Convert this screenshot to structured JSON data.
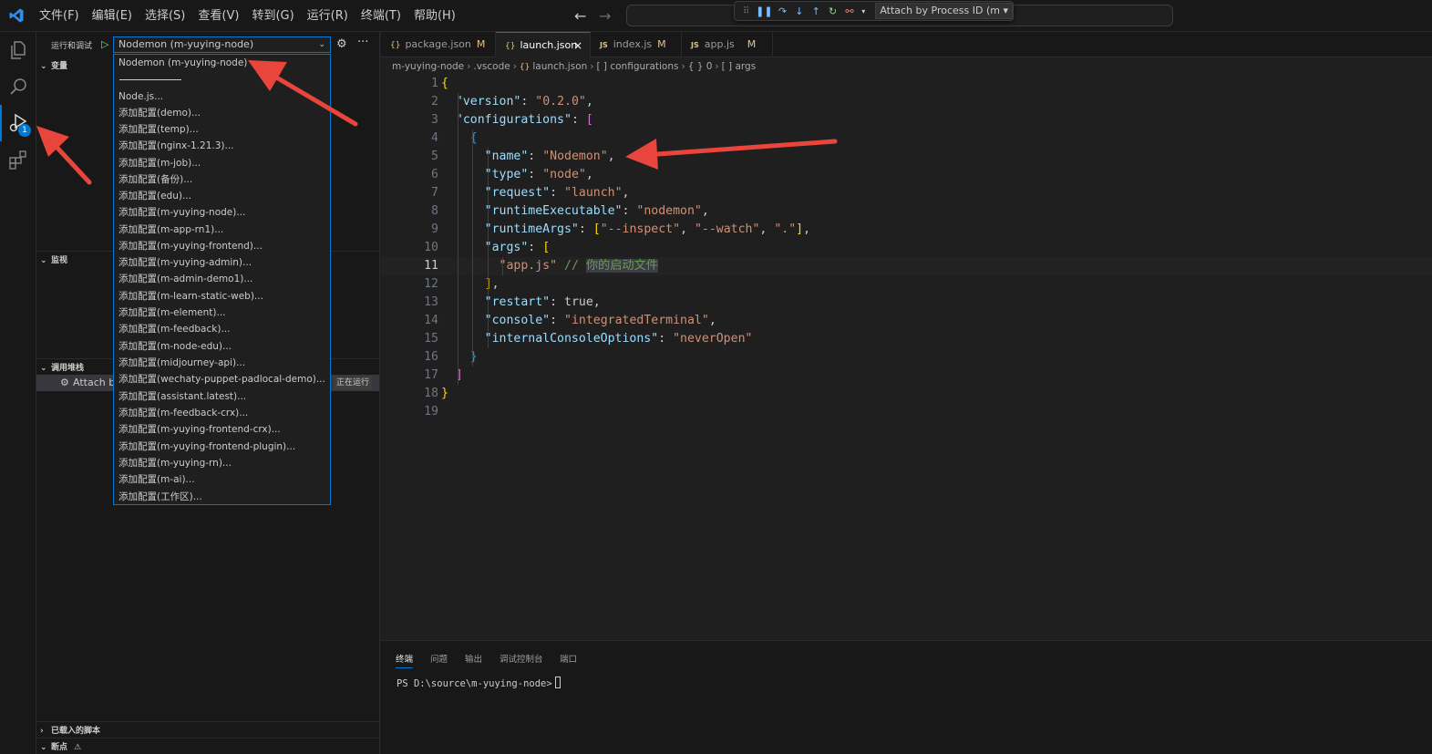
{
  "menu": [
    "文件(F)",
    "编辑(E)",
    "选择(S)",
    "查看(V)",
    "转到(G)",
    "运行(R)",
    "终端(T)",
    "帮助(H)"
  ],
  "debug_toolbar": {
    "session": "Attach by Process ID (m"
  },
  "activity": {
    "debug_badge": "1"
  },
  "sidebar": {
    "title": "运行和调试",
    "selected_config": "Nodemon (m-yuying-node)",
    "sections": {
      "variables": "变量",
      "watch": "监视",
      "callstack": "调用堆栈",
      "loaded_scripts": "已载入的脚本",
      "breakpoints": "断点"
    },
    "callstack_item": {
      "label": "Attach by",
      "status": "正在运行"
    }
  },
  "dropdown": {
    "items": [
      "Nodemon (m-yuying-node)",
      "Node.js...",
      "添加配置(demo)...",
      "添加配置(temp)...",
      "添加配置(nginx-1.21.3)...",
      "添加配置(m-job)...",
      "添加配置(备份)...",
      "添加配置(edu)...",
      "添加配置(m-yuying-node)...",
      "添加配置(m-app-rn1)...",
      "添加配置(m-yuying-frontend)...",
      "添加配置(m-yuying-admin)...",
      "添加配置(m-admin-demo1)...",
      "添加配置(m-learn-static-web)...",
      "添加配置(m-element)...",
      "添加配置(m-feedback)...",
      "添加配置(m-node-edu)...",
      "添加配置(midjourney-api)...",
      "添加配置(wechaty-puppet-padlocal-demo)...",
      "添加配置(assistant.latest)...",
      "添加配置(m-feedback-crx)...",
      "添加配置(m-yuying-frontend-crx)...",
      "添加配置(m-yuying-frontend-plugin)...",
      "添加配置(m-yuying-rn)...",
      "添加配置(m-ai)...",
      "添加配置(工作区)..."
    ]
  },
  "tabs": [
    {
      "label": "package.json",
      "icon": "{}",
      "modified": "M"
    },
    {
      "label": "launch.json",
      "icon": "{}",
      "modified": ""
    },
    {
      "label": "index.js",
      "icon": "JS",
      "modified": "M"
    },
    {
      "label": "app.js",
      "icon": "JS",
      "modified": "M"
    }
  ],
  "breadcrumb": [
    "m-yuying-node",
    ".vscode",
    "launch.json",
    "[ ] configurations",
    "{ } 0",
    "[ ] args"
  ],
  "code": {
    "line_numbers": [
      "1",
      "2",
      "3",
      "4",
      "5",
      "6",
      "7",
      "8",
      "9",
      "10",
      "11",
      "12",
      "13",
      "14",
      "15",
      "16",
      "17",
      "18",
      "19"
    ],
    "current_line": 11,
    "lines": [
      "{",
      "  \"version\": \"0.2.0\",",
      "  \"configurations\": [",
      "    {",
      "      \"name\": \"Nodemon\",",
      "      \"type\": \"node\",",
      "      \"request\": \"launch\",",
      "      \"runtimeExecutable\": \"nodemon\",",
      "      \"runtimeArgs\": [\"--inspect\", \"--watch\", \".\"],",
      "      \"args\": [",
      "        \"app.js\" // 你的启动文件",
      "      ],",
      "      \"restart\": true,",
      "      \"console\": \"integratedTerminal\",",
      "      \"internalConsoleOptions\": \"neverOpen\"",
      "    }",
      "  ]",
      "}",
      ""
    ]
  },
  "panel": {
    "tabs": [
      "终端",
      "问题",
      "输出",
      "调试控制台",
      "端口"
    ],
    "terminal_prompt": "PS D:\\source\\m-yuying-node>"
  },
  "colors": {
    "accent": "#0078d4",
    "annotation_arrow": "#e8453c"
  }
}
